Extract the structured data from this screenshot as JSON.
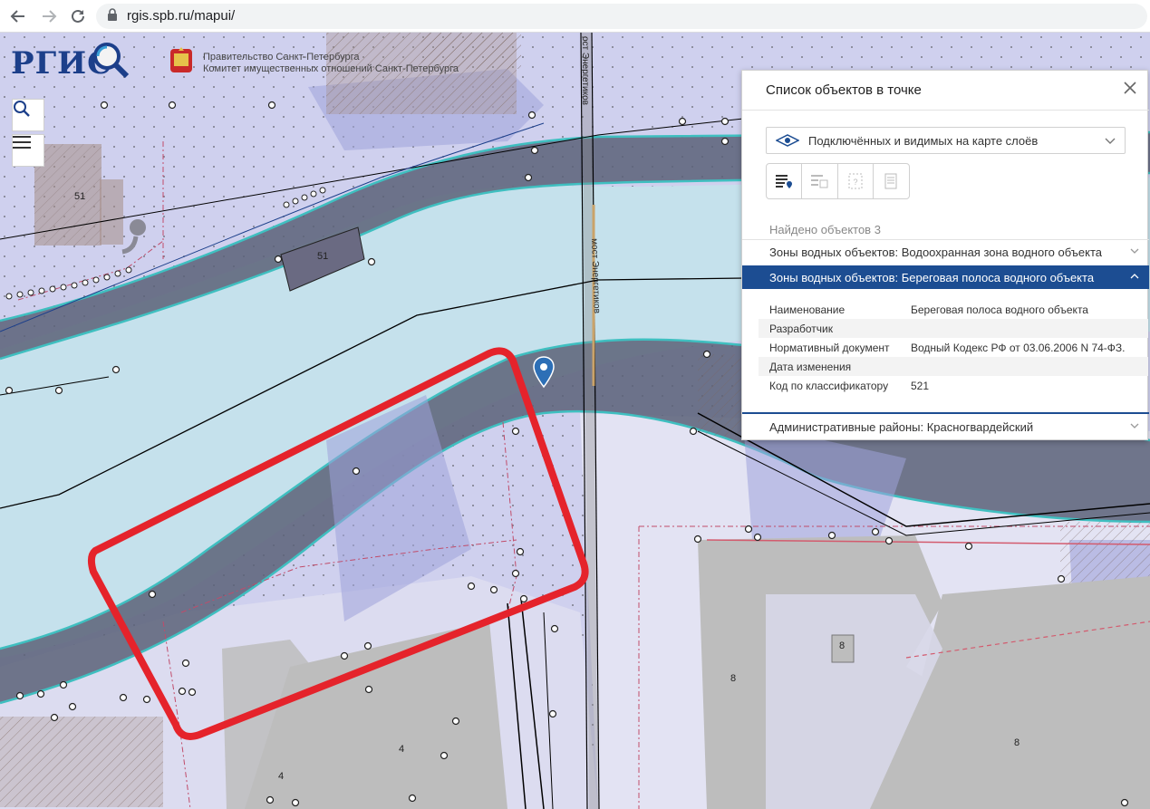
{
  "browser": {
    "url": "rgis.spb.ru/mapui/"
  },
  "header": {
    "logo_text": "РГИС",
    "gov_line1": "Правительство Санкт-Петербурга",
    "gov_line2": "Комитет имущественных отношений Санкт-Петербурга"
  },
  "map": {
    "road_label_top": "ост Энергетиков",
    "road_label_mid": "мост Энергетиков",
    "parcel_labels": {
      "p51a": "51",
      "p51b": "51",
      "p8a": "8",
      "p8b": "8",
      "p8c": "8",
      "p4a": "4",
      "p4b": "4"
    },
    "colors": {
      "water": "#c5e1ec",
      "water_zone": "#5b6178",
      "zone_fill": "#b4b6e6",
      "building": "#bdbdbd",
      "highlight": "#e5232b",
      "teal_line": "#3fbfc0"
    }
  },
  "panel": {
    "title": "Список объектов в точке",
    "layer_select": "Подключённых и видимых на карте слоёв",
    "found": "Найдено объектов 3",
    "items": [
      {
        "label": "Зоны водных объектов: Водоохранная зона водного объекта"
      },
      {
        "label": "Зоны водных объектов: Береговая полоса водного объекта"
      },
      {
        "label": "Административные районы: Красногвардейский"
      }
    ],
    "attributes": [
      {
        "key": "Наименование",
        "value": "Береговая полоса водного объекта"
      },
      {
        "key": "Разработчик",
        "value": ""
      },
      {
        "key": "Нормативный документ",
        "value": "Водный Кодекс РФ от 03.06.2006 N 74-ФЗ."
      },
      {
        "key": "Дата изменения",
        "value": ""
      },
      {
        "key": "Код по классификатору",
        "value": "521"
      }
    ]
  }
}
